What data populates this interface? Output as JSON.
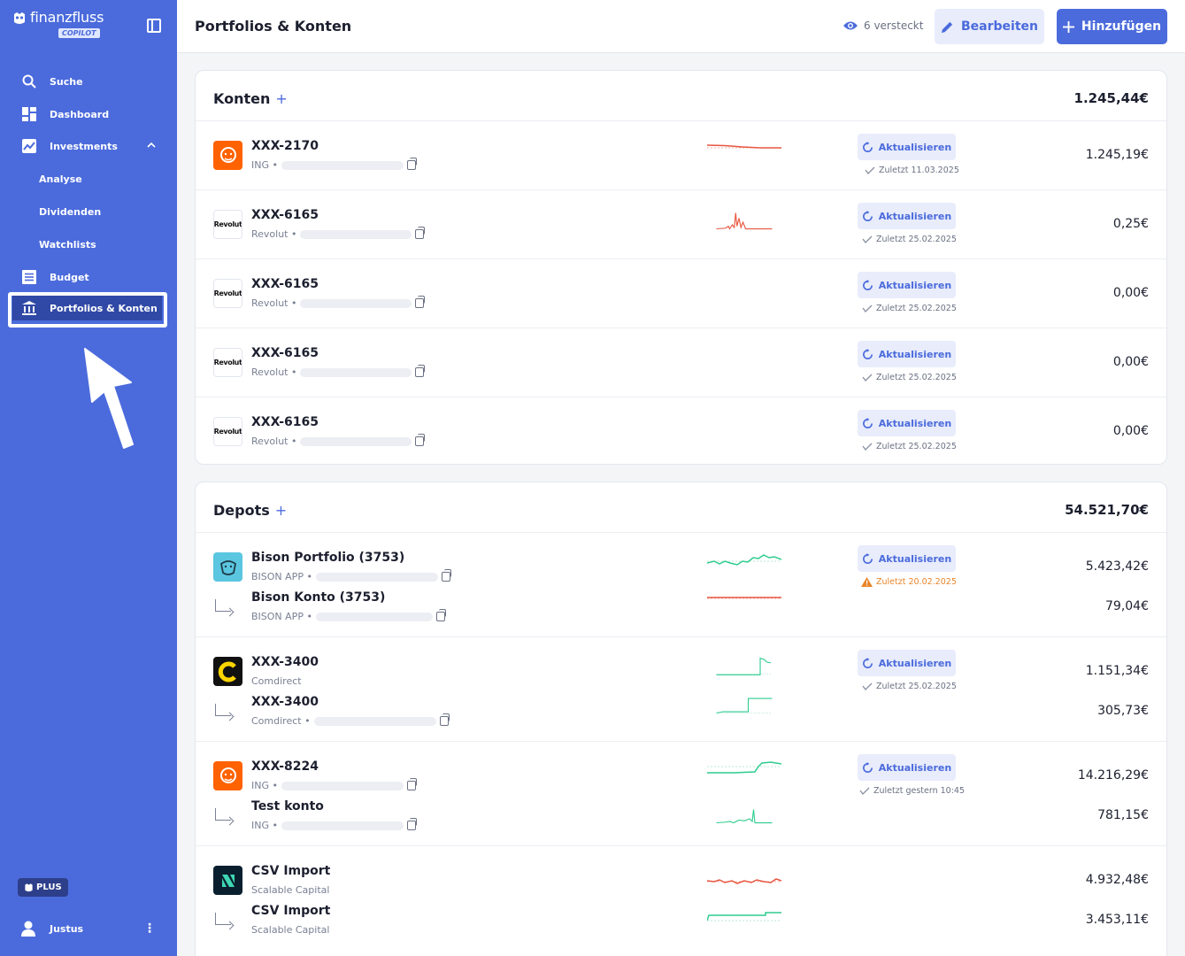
{
  "sidebar": {
    "brand": "finanzfluss",
    "badge": "COPILOT",
    "nav": {
      "search": "Suche",
      "dashboard": "Dashboard",
      "investments": "Investments",
      "analyse": "Analyse",
      "dividends": "Dividenden",
      "watchlists": "Watchlists",
      "budget": "Budget",
      "portfolios": "Portfolios & Konten"
    },
    "plan": "PLUS",
    "user": "Justus"
  },
  "header": {
    "title": "Portfolios & Konten",
    "hidden": "6 versteckt",
    "edit": "Bearbeiten",
    "add": "Hinzufügen"
  },
  "konten": {
    "title": "Konten",
    "total": "1.245,44€",
    "rows": [
      {
        "name": "XXX-2170",
        "bank": "ING •",
        "refresh": "Aktualisieren",
        "last": "Zuletzt 11.03.2025",
        "amount": "1.245,19€"
      },
      {
        "name": "XXX-6165",
        "bank": "Revolut •",
        "refresh": "Aktualisieren",
        "last": "Zuletzt 25.02.2025",
        "amount": "0,25€"
      },
      {
        "name": "XXX-6165",
        "bank": "Revolut •",
        "refresh": "Aktualisieren",
        "last": "Zuletzt 25.02.2025",
        "amount": "0,00€"
      },
      {
        "name": "XXX-6165",
        "bank": "Revolut •",
        "refresh": "Aktualisieren",
        "last": "Zuletzt 25.02.2025",
        "amount": "0,00€"
      },
      {
        "name": "XXX-6165",
        "bank": "Revolut •",
        "refresh": "Aktualisieren",
        "last": "Zuletzt 25.02.2025",
        "amount": "0,00€"
      }
    ],
    "revolut_logo": "Revolut"
  },
  "depots": {
    "title": "Depots",
    "total": "54.521,70€",
    "groups": [
      {
        "main": {
          "name": "Bison Portfolio (3753)",
          "bank": "BISON APP •",
          "amount": "5.423,42€"
        },
        "child": {
          "name": "Bison Konto (3753)",
          "bank": "BISON APP •",
          "amount": "79,04€"
        },
        "refresh": "Aktualisieren",
        "last": "Zuletzt 20.02.2025"
      },
      {
        "main": {
          "name": "XXX-3400",
          "bank": "Comdirect",
          "amount": "1.151,34€"
        },
        "child": {
          "name": "XXX-3400",
          "bank": "Comdirect •",
          "amount": "305,73€"
        },
        "refresh": "Aktualisieren",
        "last": "Zuletzt 25.02.2025"
      },
      {
        "main": {
          "name": "XXX-8224",
          "bank": "ING •",
          "amount": "14.216,29€"
        },
        "child": {
          "name": "Test konto",
          "bank": "ING •",
          "amount": "781,15€"
        },
        "refresh": "Aktualisieren",
        "last": "Zuletzt gestern 10:45"
      },
      {
        "main": {
          "name": "CSV Import",
          "bank": "Scalable Capital",
          "amount": "4.932,48€"
        },
        "child": {
          "name": "CSV Import",
          "bank": "Scalable Capital",
          "amount": "3.453,11€"
        }
      }
    ]
  },
  "colors": {
    "accent": "#4b6bdc",
    "sidebar": "#4b6bdc",
    "positive": "#2ecc8f",
    "negative": "#e8553f",
    "warning": "#e8862a"
  }
}
